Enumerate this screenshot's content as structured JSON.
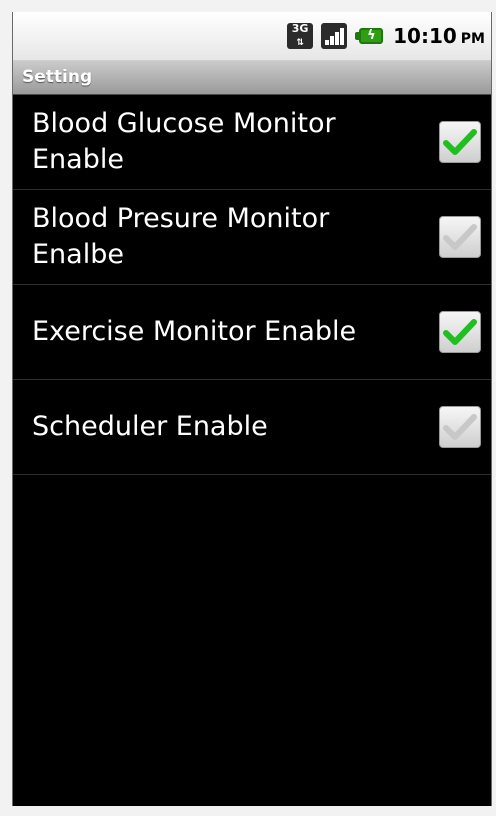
{
  "status_bar": {
    "network_type": "3G",
    "network_arrows": "⇅",
    "time": "10:10",
    "ampm": "PM"
  },
  "title_bar": {
    "title": "Setting"
  },
  "settings": [
    {
      "label": "Blood Glucose Monitor Enable",
      "checked": true
    },
    {
      "label": "Blood Presure Monitor Enalbe",
      "checked": false
    },
    {
      "label": "Exercise Monitor Enable",
      "checked": true
    },
    {
      "label": "Scheduler Enable",
      "checked": false
    }
  ],
  "colors": {
    "check_on": "#1fbf1f",
    "check_off": "#c8c8c8",
    "list_background": "#000000",
    "title_text": "#ffffff"
  }
}
